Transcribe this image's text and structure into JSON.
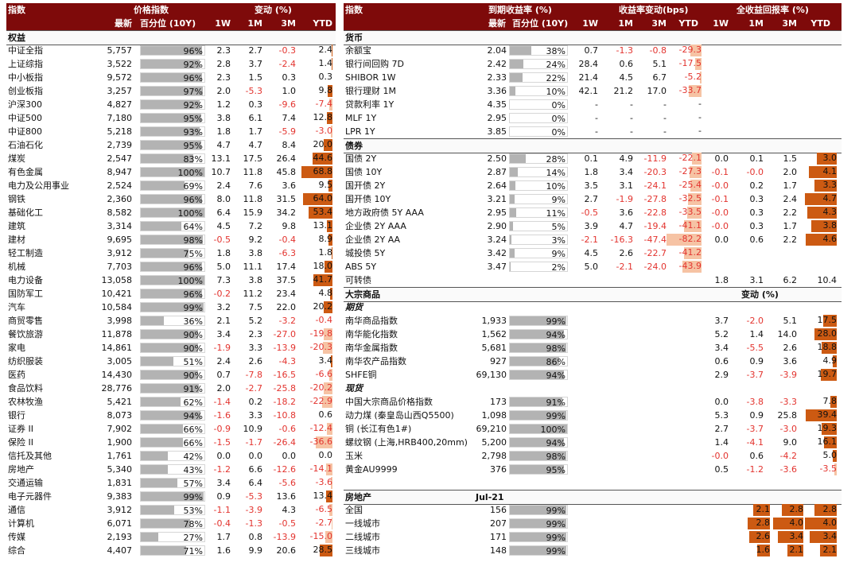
{
  "left": {
    "header": {
      "title": "指数",
      "price_group": "价格指数",
      "change_group": "变动 (%)",
      "col_latest": "最新",
      "col_pct": "百分位 (10Y)",
      "col_1w": "1W",
      "col_1m": "1M",
      "col_3m": "3M",
      "col_ytd": "YTD"
    },
    "section_equity": "权益",
    "rows": [
      {
        "name": "中证全指",
        "latest": "5,757",
        "pct": "96%",
        "pctv": 96,
        "w1": "2.3",
        "m1": "2.7",
        "m3": "-0.3",
        "ytd": "2.4",
        "ytdv": 2.4
      },
      {
        "name": "上证综指",
        "latest": "3,522",
        "pct": "92%",
        "pctv": 92,
        "w1": "2.8",
        "m1": "3.7",
        "m3": "-2.4",
        "ytd": "1.4",
        "ytdv": 1.4
      },
      {
        "name": "中小板指",
        "latest": "9,572",
        "pct": "96%",
        "pctv": 96,
        "w1": "2.3",
        "m1": "1.5",
        "m3": "0.3",
        "ytd": "0.3",
        "ytdv": 0.3
      },
      {
        "name": "创业板指",
        "latest": "3,257",
        "pct": "97%",
        "pctv": 97,
        "w1": "2.0",
        "m1": "-5.3",
        "m3": "1.0",
        "ytd": "9.8",
        "ytdv": 9.8
      },
      {
        "name": "沪深300",
        "latest": "4,827",
        "pct": "92%",
        "pctv": 92,
        "w1": "1.2",
        "m1": "0.3",
        "m3": "-9.6",
        "ytd": "-7.4",
        "ytdv": -7.4
      },
      {
        "name": "中证500",
        "latest": "7,180",
        "pct": "95%",
        "pctv": 95,
        "w1": "3.8",
        "m1": "6.1",
        "m3": "7.4",
        "ytd": "12.8",
        "ytdv": 12.8
      },
      {
        "name": "中证800",
        "latest": "5,218",
        "pct": "93%",
        "pctv": 93,
        "w1": "1.8",
        "m1": "1.7",
        "m3": "-5.9",
        "ytd": "-3.0",
        "ytdv": -3.0
      },
      {
        "name": "石油石化",
        "latest": "2,739",
        "pct": "95%",
        "pctv": 95,
        "w1": "4.7",
        "m1": "4.7",
        "m3": "8.4",
        "ytd": "20.0",
        "ytdv": 20.0
      },
      {
        "name": "煤炭",
        "latest": "2,547",
        "pct": "83%",
        "pctv": 83,
        "w1": "13.1",
        "m1": "17.5",
        "m3": "26.4",
        "ytd": "44.6",
        "ytdv": 44.6
      },
      {
        "name": "有色金属",
        "latest": "8,947",
        "pct": "100%",
        "pctv": 100,
        "w1": "10.7",
        "m1": "11.8",
        "m3": "45.8",
        "ytd": "68.8",
        "ytdv": 68.8
      },
      {
        "name": "电力及公用事业",
        "latest": "2,524",
        "pct": "69%",
        "pctv": 69,
        "w1": "2.4",
        "m1": "7.6",
        "m3": "3.6",
        "ytd": "9.5",
        "ytdv": 9.5
      },
      {
        "name": "钢铁",
        "latest": "2,360",
        "pct": "96%",
        "pctv": 96,
        "w1": "8.0",
        "m1": "11.8",
        "m3": "31.5",
        "ytd": "64.0",
        "ytdv": 64.0
      },
      {
        "name": "基础化工",
        "latest": "8,582",
        "pct": "100%",
        "pctv": 100,
        "w1": "6.4",
        "m1": "15.9",
        "m3": "34.2",
        "ytd": "53.4",
        "ytdv": 53.4
      },
      {
        "name": "建筑",
        "latest": "3,314",
        "pct": "64%",
        "pctv": 64,
        "w1": "4.5",
        "m1": "7.2",
        "m3": "9.8",
        "ytd": "13.1",
        "ytdv": 13.1
      },
      {
        "name": "建材",
        "latest": "9,695",
        "pct": "98%",
        "pctv": 98,
        "w1": "-0.5",
        "m1": "9.2",
        "m3": "-0.4",
        "ytd": "8.9",
        "ytdv": 8.9
      },
      {
        "name": "轻工制造",
        "latest": "3,912",
        "pct": "75%",
        "pctv": 75,
        "w1": "1.8",
        "m1": "3.8",
        "m3": "-6.3",
        "ytd": "1.8",
        "ytdv": 1.8
      },
      {
        "name": "机械",
        "latest": "7,703",
        "pct": "96%",
        "pctv": 96,
        "w1": "5.0",
        "m1": "11.1",
        "m3": "17.4",
        "ytd": "18.0",
        "ytdv": 18.0
      },
      {
        "name": "电力设备",
        "latest": "13,058",
        "pct": "100%",
        "pctv": 100,
        "w1": "7.3",
        "m1": "3.8",
        "m3": "37.5",
        "ytd": "41.7",
        "ytdv": 41.7
      },
      {
        "name": "国防军工",
        "latest": "10,421",
        "pct": "96%",
        "pctv": 96,
        "w1": "-0.2",
        "m1": "11.2",
        "m3": "23.4",
        "ytd": "4.8",
        "ytdv": 4.8
      },
      {
        "name": "汽车",
        "latest": "10,584",
        "pct": "99%",
        "pctv": 99,
        "w1": "3.2",
        "m1": "7.5",
        "m3": "22.0",
        "ytd": "20.2",
        "ytdv": 20.2
      },
      {
        "name": "商贸零售",
        "latest": "3,998",
        "pct": "36%",
        "pctv": 36,
        "w1": "2.1",
        "m1": "5.2",
        "m3": "-3.2",
        "ytd": "-0.4",
        "ytdv": -0.4
      },
      {
        "name": "餐饮旅游",
        "latest": "11,878",
        "pct": "90%",
        "pctv": 90,
        "w1": "3.4",
        "m1": "2.3",
        "m3": "-27.0",
        "ytd": "-19.8",
        "ytdv": -19.8
      },
      {
        "name": "家电",
        "latest": "14,861",
        "pct": "90%",
        "pctv": 90,
        "w1": "-1.9",
        "m1": "3.3",
        "m3": "-13.9",
        "ytd": "-20.3",
        "ytdv": -20.3
      },
      {
        "name": "纺织服装",
        "latest": "3,005",
        "pct": "51%",
        "pctv": 51,
        "w1": "2.4",
        "m1": "2.6",
        "m3": "-4.3",
        "ytd": "3.4",
        "ytdv": 3.4
      },
      {
        "name": "医药",
        "latest": "14,430",
        "pct": "90%",
        "pctv": 90,
        "w1": "0.7",
        "m1": "-7.8",
        "m3": "-16.5",
        "ytd": "-6.6",
        "ytdv": -6.6
      },
      {
        "name": "食品饮料",
        "latest": "28,776",
        "pct": "91%",
        "pctv": 91,
        "w1": "2.0",
        "m1": "-2.7",
        "m3": "-25.8",
        "ytd": "-20.2",
        "ytdv": -20.2
      },
      {
        "name": "农林牧渔",
        "latest": "5,421",
        "pct": "62%",
        "pctv": 62,
        "w1": "-1.4",
        "m1": "0.2",
        "m3": "-18.2",
        "ytd": "-22.9",
        "ytdv": -22.9
      },
      {
        "name": "银行",
        "latest": "8,073",
        "pct": "94%",
        "pctv": 94,
        "w1": "-1.6",
        "m1": "3.3",
        "m3": "-10.8",
        "ytd": "0.6",
        "ytdv": 0.6
      },
      {
        "name": "证券 II",
        "latest": "7,902",
        "pct": "66%",
        "pctv": 66,
        "w1": "-0.9",
        "m1": "10.9",
        "m3": "-0.6",
        "ytd": "-12.4",
        "ytdv": -12.4
      },
      {
        "name": "保险 II",
        "latest": "1,900",
        "pct": "66%",
        "pctv": 66,
        "w1": "-1.5",
        "m1": "-1.7",
        "m3": "-26.4",
        "ytd": "-36.6",
        "ytdv": -36.6
      },
      {
        "name": "信托及其他",
        "latest": "1,761",
        "pct": "42%",
        "pctv": 42,
        "w1": "0.0",
        "m1": "0.0",
        "m3": "0.0",
        "ytd": "0.0",
        "ytdv": 0.0
      },
      {
        "name": "房地产",
        "latest": "5,340",
        "pct": "43%",
        "pctv": 43,
        "w1": "-1.2",
        "m1": "6.6",
        "m3": "-12.6",
        "ytd": "-14.1",
        "ytdv": -14.1
      },
      {
        "name": "交通运输",
        "latest": "1,831",
        "pct": "57%",
        "pctv": 57,
        "w1": "3.4",
        "m1": "6.4",
        "m3": "-5.6",
        "ytd": "-3.6",
        "ytdv": -3.6
      },
      {
        "name": "电子元器件",
        "latest": "9,383",
        "pct": "99%",
        "pctv": 99,
        "w1": "0.9",
        "m1": "-5.3",
        "m3": "13.6",
        "ytd": "13.4",
        "ytdv": 13.4
      },
      {
        "name": "通信",
        "latest": "3,912",
        "pct": "53%",
        "pctv": 53,
        "w1": "-1.1",
        "m1": "-3.9",
        "m3": "4.3",
        "ytd": "-6.5",
        "ytdv": -6.5
      },
      {
        "name": "计算机",
        "latest": "6,071",
        "pct": "78%",
        "pctv": 78,
        "w1": "-0.4",
        "m1": "-1.3",
        "m3": "-0.5",
        "ytd": "-2.7",
        "ytdv": -2.7
      },
      {
        "name": "传媒",
        "latest": "2,193",
        "pct": "27%",
        "pctv": 27,
        "w1": "1.7",
        "m1": "0.8",
        "m3": "-13.9",
        "ytd": "-15.0",
        "ytdv": -15.0
      },
      {
        "name": "综合",
        "latest": "4,407",
        "pct": "71%",
        "pctv": 71,
        "w1": "1.6",
        "m1": "9.9",
        "m3": "20.6",
        "ytd": "28.5",
        "ytdv": 28.5
      }
    ]
  },
  "right": {
    "header": {
      "title": "指数",
      "yield_group": "到期收益率 (%)",
      "ychg_group": "收益率变动(bps)",
      "ret_group": "全收益回报率 (%)",
      "col_latest": "最新",
      "col_pct": "百分位 (10Y)",
      "col_1w": "1W",
      "col_1m": "1M",
      "col_3m": "3M",
      "col_ytd": "YTD",
      "col_r1w": "1W",
      "col_r1m": "1M",
      "col_r3m": "3M",
      "col_rytd": "YTD"
    },
    "section_money": "货币",
    "money": [
      {
        "name": "余额宝",
        "latest": "2.04",
        "pct": "38%",
        "pctv": 38,
        "w1": "0.7",
        "m1": "-1.3",
        "m3": "-0.8",
        "ytd": "-29.3",
        "ytdv": -29.3
      },
      {
        "name": "银行间回购 7D",
        "latest": "2.42",
        "pct": "24%",
        "pctv": 24,
        "w1": "28.4",
        "m1": "0.6",
        "m3": "5.1",
        "ytd": "-17.5",
        "ytdv": -17.5
      },
      {
        "name": "SHIBOR 1W",
        "latest": "2.33",
        "pct": "22%",
        "pctv": 22,
        "w1": "21.4",
        "m1": "4.5",
        "m3": "6.7",
        "ytd": "-5.2",
        "ytdv": -5.2
      },
      {
        "name": "银行理财 1M",
        "latest": "3.36",
        "pct": "10%",
        "pctv": 10,
        "w1": "42.1",
        "m1": "21.2",
        "m3": "17.0",
        "ytd": "-33.7",
        "ytdv": -33.7
      },
      {
        "name": "贷款利率 1Y",
        "latest": "4.35",
        "pct": "0%",
        "pctv": 0,
        "w1": "-",
        "m1": "-",
        "m3": "-",
        "ytd": "-",
        "ytdv": 0
      },
      {
        "name": "MLF 1Y",
        "latest": "2.95",
        "pct": "0%",
        "pctv": 0,
        "w1": "-",
        "m1": "-",
        "m3": "-",
        "ytd": "-",
        "ytdv": 0
      },
      {
        "name": "LPR 1Y",
        "latest": "3.85",
        "pct": "0%",
        "pctv": 0,
        "w1": "-",
        "m1": "-",
        "m3": "-",
        "ytd": "-",
        "ytdv": 0
      }
    ],
    "section_bond": "债券",
    "bonds": [
      {
        "name": "国债 2Y",
        "latest": "2.50",
        "pct": "28%",
        "pctv": 28,
        "w1": "0.1",
        "m1": "4.9",
        "m3": "-11.9",
        "ytd": "-22.1",
        "ytdv": -22.1,
        "r1w": "0.0",
        "r1m": "0.1",
        "r3m": "1.5",
        "rytd": "3.0",
        "rytdv": 3.0
      },
      {
        "name": "国债 10Y",
        "latest": "2.87",
        "pct": "14%",
        "pctv": 14,
        "w1": "1.8",
        "m1": "3.4",
        "m3": "-20.3",
        "ytd": "-27.3",
        "ytdv": -27.3,
        "r1w": "-0.1",
        "r1m": "-0.0",
        "r3m": "2.0",
        "rytd": "4.1",
        "rytdv": 4.1
      },
      {
        "name": "国开债 2Y",
        "latest": "2.64",
        "pct": "10%",
        "pctv": 10,
        "w1": "3.5",
        "m1": "3.1",
        "m3": "-24.1",
        "ytd": "-25.4",
        "ytdv": -25.4,
        "r1w": "-0.0",
        "r1m": "0.2",
        "r3m": "1.7",
        "rytd": "3.3",
        "rytdv": 3.3
      },
      {
        "name": "国开债 10Y",
        "latest": "3.21",
        "pct": "9%",
        "pctv": 9,
        "w1": "2.7",
        "m1": "-1.9",
        "m3": "-27.8",
        "ytd": "-32.5",
        "ytdv": -32.5,
        "r1w": "-0.1",
        "r1m": "0.3",
        "r3m": "2.4",
        "rytd": "4.7",
        "rytdv": 4.7
      },
      {
        "name": "地方政府债 5Y AAA",
        "latest": "2.95",
        "pct": "11%",
        "pctv": 11,
        "w1": "-0.5",
        "m1": "3.6",
        "m3": "-22.8",
        "ytd": "-33.5",
        "ytdv": -33.5,
        "r1w": "-0.0",
        "r1m": "0.3",
        "r3m": "2.2",
        "rytd": "4.3",
        "rytdv": 4.3
      },
      {
        "name": "企业债 2Y AAA",
        "latest": "2.90",
        "pct": "5%",
        "pctv": 5,
        "w1": "3.9",
        "m1": "4.7",
        "m3": "-19.4",
        "ytd": "-41.1",
        "ytdv": -41.1,
        "r1w": "-0.0",
        "r1m": "0.3",
        "r3m": "1.7",
        "rytd": "3.8",
        "rytdv": 3.8
      },
      {
        "name": "企业债 2Y AA",
        "latest": "3.24",
        "pct": "3%",
        "pctv": 3,
        "w1": "-2.1",
        "m1": "-16.3",
        "m3": "-47.4",
        "ytd": "-82.2",
        "ytdv": -82.2,
        "r1w": "0.0",
        "r1m": "0.6",
        "r3m": "2.2",
        "rytd": "4.6",
        "rytdv": 4.6
      },
      {
        "name": "城投债 5Y",
        "latest": "3.42",
        "pct": "9%",
        "pctv": 9,
        "w1": "4.5",
        "m1": "2.6",
        "m3": "-22.7",
        "ytd": "-41.2",
        "ytdv": -41.2,
        "r1w": "",
        "r1m": "",
        "r3m": "",
        "rytd": "",
        "rytdv": 0
      },
      {
        "name": "ABS 5Y",
        "latest": "3.47",
        "pct": "2%",
        "pctv": 2,
        "w1": "5.0",
        "m1": "-2.1",
        "m3": "-24.0",
        "ytd": "-43.9",
        "ytdv": -43.9,
        "r1w": "",
        "r1m": "",
        "r3m": "",
        "rytd": "",
        "rytdv": 0
      }
    ],
    "convertible": {
      "name": "可转债",
      "r1w": "1.8",
      "r1m": "3.1",
      "r3m": "6.2",
      "rytd": "10.4"
    },
    "section_commod": "大宗商品",
    "commod_change": "变动 (%)",
    "sub_futures": "期货",
    "futures": [
      {
        "name": "南华商品指数",
        "latest": "1,933",
        "pct": "99%",
        "pctv": 99,
        "w1": "3.7",
        "m1": "-2.0",
        "m3": "5.1",
        "ytd": "17.5",
        "ytdv": 17.5
      },
      {
        "name": "南华能化指数",
        "latest": "1,562",
        "pct": "94%",
        "pctv": 94,
        "w1": "5.2",
        "m1": "1.4",
        "m3": "14.0",
        "ytd": "28.0",
        "ytdv": 28.0
      },
      {
        "name": "南华金属指数",
        "latest": "5,681",
        "pct": "98%",
        "pctv": 98,
        "w1": "3.4",
        "m1": "-5.5",
        "m3": "2.6",
        "ytd": "18.8",
        "ytdv": 18.8
      },
      {
        "name": "南华农产品指数",
        "latest": "927",
        "pct": "86%",
        "pctv": 86,
        "w1": "0.6",
        "m1": "0.9",
        "m3": "3.6",
        "ytd": "4.9",
        "ytdv": 4.9
      },
      {
        "name": "SHFE铜",
        "latest": "69,130",
        "pct": "94%",
        "pctv": 94,
        "w1": "2.9",
        "m1": "-3.7",
        "m3": "-3.9",
        "ytd": "19.7",
        "ytdv": 19.7
      }
    ],
    "sub_spot": "现货",
    "spot": [
      {
        "name": "中国大宗商品价格指数",
        "latest": "173",
        "pct": "91%",
        "pctv": 91,
        "w1": "0.0",
        "m1": "-3.8",
        "m3": "-3.3",
        "ytd": "7.8",
        "ytdv": 7.8
      },
      {
        "name": "动力煤 (秦皇岛山西Q5500)",
        "latest": "1,098",
        "pct": "99%",
        "pctv": 99,
        "w1": "5.3",
        "m1": "0.9",
        "m3": "25.8",
        "ytd": "39.4",
        "ytdv": 39.4
      },
      {
        "name": "铜 (长江有色1#)",
        "latest": "69,210",
        "pct": "100%",
        "pctv": 100,
        "w1": "2.7",
        "m1": "-3.7",
        "m3": "-3.0",
        "ytd": "19.3",
        "ytdv": 19.3
      },
      {
        "name": "螺纹钢 (上海,HRB400,20mm)",
        "latest": "5,200",
        "pct": "94%",
        "pctv": 94,
        "w1": "1.4",
        "m1": "-4.1",
        "m3": "9.0",
        "ytd": "16.1",
        "ytdv": 16.1
      },
      {
        "name": "玉米",
        "latest": "2,798",
        "pct": "98%",
        "pctv": 98,
        "w1": "-0.0",
        "m1": "0.6",
        "m3": "-4.2",
        "ytd": "5.0",
        "ytdv": 5.0
      },
      {
        "name": "黄金AU9999",
        "latest": "376",
        "pct": "95%",
        "pctv": 95,
        "w1": "0.5",
        "m1": "-1.2",
        "m3": "-3.6",
        "ytd": "-3.5",
        "ytdv": -3.5
      }
    ],
    "section_realestate": "房地产",
    "realestate_date": "Jul-21",
    "realestate": [
      {
        "name": "全国",
        "latest": "156",
        "pct": "99%",
        "pctv": 99,
        "m1": "2.1",
        "m3": "2.8",
        "ytd": "2.8",
        "m1v": 2.1,
        "m3v": 2.8,
        "ytdv": 2.8
      },
      {
        "name": "一线城市",
        "latest": "207",
        "pct": "99%",
        "pctv": 99,
        "m1": "2.8",
        "m3": "4.0",
        "ytd": "4.0",
        "m1v": 2.8,
        "m3v": 4.0,
        "ytdv": 4.0
      },
      {
        "name": "二线城市",
        "latest": "171",
        "pct": "99%",
        "pctv": 99,
        "m1": "2.6",
        "m3": "3.4",
        "ytd": "3.4",
        "m1v": 2.6,
        "m3v": 3.4,
        "ytdv": 3.4
      },
      {
        "name": "三线城市",
        "latest": "148",
        "pct": "99%",
        "pctv": 99,
        "m1": "1.6",
        "m3": "2.1",
        "ytd": "2.1",
        "m1v": 1.6,
        "m3v": 2.1,
        "ytdv": 2.1
      }
    ]
  }
}
